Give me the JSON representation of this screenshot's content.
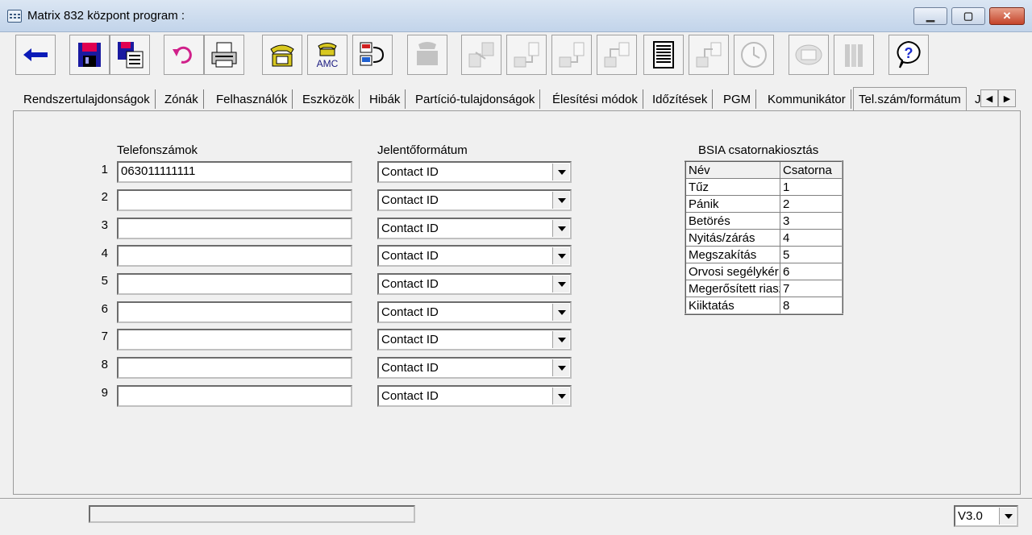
{
  "window": {
    "title": "Matrix 832 központ program :"
  },
  "toolbar": {
    "buttons": [
      {
        "icon": "back-arrow-icon",
        "enabled": true
      },
      {
        "icon": "save-disk-icon",
        "enabled": true
      },
      {
        "icon": "save-as-icon",
        "enabled": true
      },
      {
        "icon": "undo-icon",
        "enabled": true
      },
      {
        "icon": "printer-icon",
        "enabled": true
      },
      {
        "icon": "telephone-icon",
        "enabled": true
      },
      {
        "icon": "amc-phone-icon",
        "label": "AMC",
        "enabled": true
      },
      {
        "icon": "computer-connect-icon",
        "enabled": true
      },
      {
        "icon": "fax-icon",
        "enabled": false
      },
      {
        "icon": "transfer-icon",
        "enabled": false
      },
      {
        "icon": "download-icon",
        "enabled": false
      },
      {
        "icon": "upload-icon",
        "enabled": false
      },
      {
        "icon": "export-icon",
        "enabled": false
      },
      {
        "icon": "document-list-icon",
        "enabled": true
      },
      {
        "icon": "import-icon",
        "enabled": false
      },
      {
        "icon": "clock-icon",
        "enabled": false
      },
      {
        "icon": "keypad-icon",
        "enabled": false
      },
      {
        "icon": "books-icon",
        "enabled": false
      },
      {
        "icon": "help-question-icon",
        "enabled": true
      }
    ]
  },
  "tabs": [
    {
      "label": "Rendszertulajdonságok",
      "active": false
    },
    {
      "label": "Zónák",
      "active": false
    },
    {
      "label": "Felhasználók",
      "active": false
    },
    {
      "label": "Eszközök",
      "active": false
    },
    {
      "label": "Hibák",
      "active": false
    },
    {
      "label": "Partíció-tulajdonságok",
      "active": false
    },
    {
      "label": "Élesítési módok",
      "active": false
    },
    {
      "label": "Időzítések",
      "active": false
    },
    {
      "label": "PGM",
      "active": false
    },
    {
      "label": "Kommunikátor",
      "active": false
    },
    {
      "label": "Tel.szám/formátum",
      "active": true
    },
    {
      "label": "J",
      "active": false
    }
  ],
  "phones": {
    "header": "Telefonszámok",
    "rows": [
      {
        "num": "1",
        "value": "063011111111"
      },
      {
        "num": "2",
        "value": ""
      },
      {
        "num": "3",
        "value": ""
      },
      {
        "num": "4",
        "value": ""
      },
      {
        "num": "5",
        "value": ""
      },
      {
        "num": "6",
        "value": ""
      },
      {
        "num": "7",
        "value": ""
      },
      {
        "num": "8",
        "value": ""
      },
      {
        "num": "9",
        "value": ""
      }
    ]
  },
  "formats": {
    "header": "Jelentőformátum",
    "values": [
      "Contact ID",
      "Contact ID",
      "Contact ID",
      "Contact ID",
      "Contact ID",
      "Contact ID",
      "Contact ID",
      "Contact ID",
      "Contact ID"
    ]
  },
  "bsia": {
    "title": "BSIA csatornakiosztás",
    "headers": [
      "Név",
      "Csatorna"
    ],
    "rows": [
      [
        "Tűz",
        "1"
      ],
      [
        "Pánik",
        "2"
      ],
      [
        "Betörés",
        "3"
      ],
      [
        "Nyitás/zárás",
        "4"
      ],
      [
        "Megszakítás",
        "5"
      ],
      [
        "Orvosi segélykér",
        "6"
      ],
      [
        "Megerősített riasztás",
        "7"
      ],
      [
        "Kiiktatás",
        "8"
      ]
    ]
  },
  "status": {
    "version": "V3.0"
  }
}
